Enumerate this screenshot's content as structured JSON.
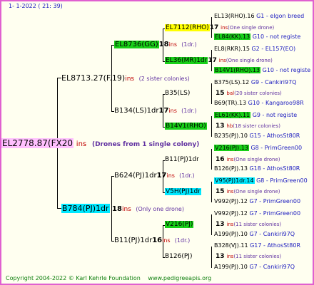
{
  "header": {
    "date": "1-   1-2022  ( 21:  39)"
  },
  "footer": {
    "copyright": "Copyright 2004-2022 © Karl Kehrle Foundation",
    "site": "www.pedigreeapis.org"
  },
  "colors": {
    "frame": "#e060d0",
    "bg": "#fffff0",
    "pink": "#ffc0ff",
    "green": "#18d018",
    "cyan": "#00e8ff",
    "yellow": "#ffff00",
    "blue": "#2020c0",
    "red": "#c00000",
    "purple": "#6030a0",
    "footer": "#108010"
  },
  "root": {
    "name": "EL2778.87(FX20",
    "ins_label": "ins",
    "note": "(Drones from 1 single colony)"
  },
  "m1": {
    "name": "EL8713.27(F.19)",
    "ins_label": "ins",
    "note": "(2 sister colonies)"
  },
  "m2": {
    "name": "B784(PJ)1dr",
    "num": "18",
    "ins_label": "ins",
    "note": "(Only one drone)"
  },
  "mm1": {
    "name": "EL8736(GG)",
    "num": "18",
    "ins_label": "ins",
    "note": "(1dr.)"
  },
  "mm2": {
    "name": "B134(LS)1dr",
    "num": "17",
    "ins_label": "ins",
    "note": "(1dr.)"
  },
  "mm3": {
    "name": "B624(PJ)1dr",
    "num": "17",
    "ins_label": "ins",
    "note": "(1dr.)"
  },
  "mm4": {
    "name": "B11(PJ)1dr",
    "num": "16",
    "ins_label": "ins",
    "note": "(1dr.)"
  },
  "g3": [
    {
      "name": "EL7112(RHO)",
      "num": "17",
      "ins_label": "ins",
      "note": "(One single drone)"
    },
    {
      "name": "EL36(MR)1dr",
      "num": "17",
      "ins_label": "ins",
      "note": "(One single drone)"
    },
    {
      "name": "B35(LS)",
      "num": "15",
      "ins_label": "bal",
      "note": "(20 sister colonies)"
    },
    {
      "name": "B14V1(RHO)",
      "num": "13",
      "ins_label": "hb",
      "note": "(18 sister colonies)"
    },
    {
      "name": "B11(PJ)1dr",
      "num": "16",
      "ins_label": "ins",
      "note": "(One single drone)"
    },
    {
      "name": "V5H(PJ)1dr",
      "num": "15",
      "ins_label": "ins",
      "note": "(One single drone)"
    },
    {
      "name": "V216(PJ)",
      "num": "13",
      "ins_label": "ins",
      "note": "(11 sister colonies)"
    },
    {
      "name": "B126(PJ)",
      "num": "13",
      "ins_label": "ins",
      "note": "(11 sister colonies)"
    }
  ],
  "g4": [
    {
      "name": "EL13(RHO).16",
      "info": "G1 - elgon breed"
    },
    {
      "name": "EL84(KK).13",
      "info": "G10 - not registe"
    },
    {
      "name": "EL8(RKR).15",
      "info": "G2 - EL157(EO)"
    },
    {
      "name": "B14V1(RHO).13",
      "info": "G10 - not registe"
    },
    {
      "name": "B375(LS).12",
      "info": "G9 - Cankiri97Q"
    },
    {
      "name": "B69(TR).13",
      "info": "G10 - Kangaroo98R"
    },
    {
      "name": "EL61(KK).11",
      "info": "G9 - not registe"
    },
    {
      "name": "B235(PJ).10",
      "info": "G15 - AthosSt80R"
    },
    {
      "name": "V216(PJ).13",
      "info": "G8 - PrimGreen00"
    },
    {
      "name": "B126(PJ).13",
      "info": "G18 - AthosSt80R"
    },
    {
      "name": "V95(PJ)1dr.14",
      "info": "G8 - PrimGreen00"
    },
    {
      "name": "V992(PJ).12",
      "info": "G7 - PrimGreen00"
    },
    {
      "name": "V992(PJ).12",
      "info": "G7 - PrimGreen00"
    },
    {
      "name": "A199(PJ).10",
      "info": "G7 - Cankiri97Q"
    },
    {
      "name": "B328(VJ).11",
      "info": "G17 - AthosSt80R"
    },
    {
      "name": "A199(PJ).10",
      "info": "G7 - Cankiri97Q"
    }
  ]
}
